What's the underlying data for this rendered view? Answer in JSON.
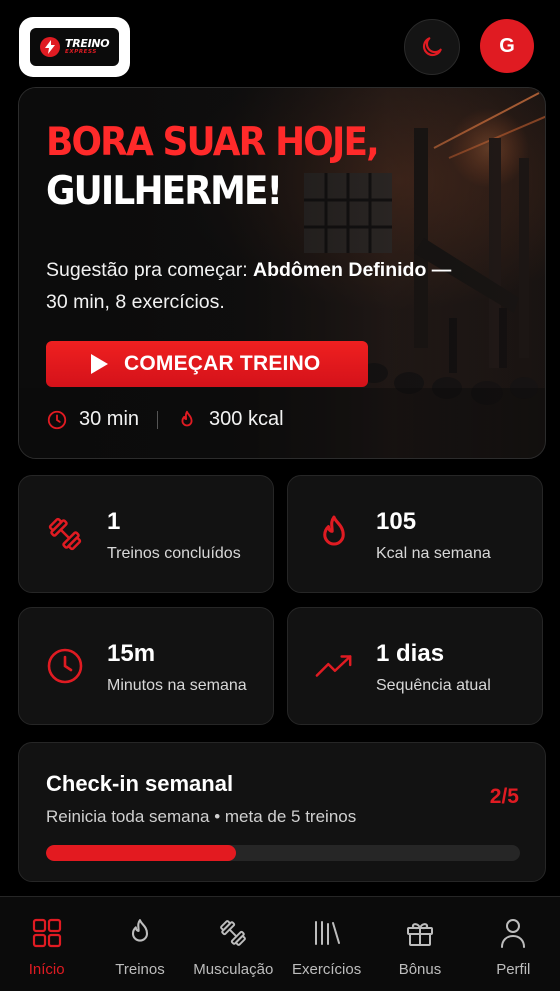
{
  "header": {
    "logo_line1": "TREINO",
    "logo_line2": "EXPRESS",
    "avatar_initial": "G"
  },
  "hero": {
    "title_line1": "BORA SUAR HOJE,",
    "title_line2": "GUILHERME!",
    "suggestion_prefix": "Sugestão pra começar: ",
    "suggestion_workout": "Abdômen Definido —",
    "suggestion_details": "30 min, 8 exercícios.",
    "start_button": "COMEÇAR TREINO",
    "duration": "30 min",
    "calories": "300 kcal"
  },
  "stats": [
    {
      "value": "1",
      "label": "Treinos concluídos",
      "icon": "dumbbell-icon"
    },
    {
      "value": "105",
      "label": "Kcal na semana",
      "icon": "flame-icon"
    },
    {
      "value": "15m",
      "label": "Minutos na semana",
      "icon": "clock-icon"
    },
    {
      "value": "1 dias",
      "label": "Sequência atual",
      "icon": "trending-up-icon"
    }
  ],
  "checkin": {
    "title": "Check-in semanal",
    "subtitle": "Reinicia toda semana • meta de 5 treinos",
    "count": "2/5",
    "progress": 0.4
  },
  "nav": [
    {
      "label": "Início",
      "icon": "grid-icon",
      "active": true
    },
    {
      "label": "Treinos",
      "icon": "flame-icon",
      "active": false
    },
    {
      "label": "Musculação",
      "icon": "dumbbell-icon",
      "active": false
    },
    {
      "label": "Exercícios",
      "icon": "library-icon",
      "active": false
    },
    {
      "label": "Bônus",
      "icon": "gift-icon",
      "active": false
    },
    {
      "label": "Perfil",
      "icon": "user-icon",
      "active": false
    }
  ],
  "colors": {
    "accent": "#e01b22",
    "background": "#000000",
    "card": "#121212"
  }
}
